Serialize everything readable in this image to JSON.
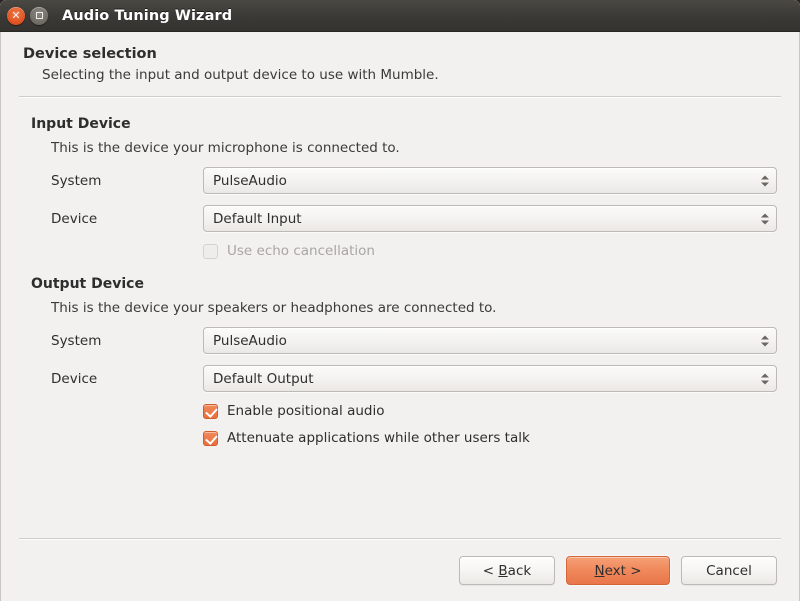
{
  "window": {
    "title": "Audio Tuning Wizard",
    "close_icon": "close-icon",
    "maximize_icon": "maximize-icon"
  },
  "header": {
    "title": "Device selection",
    "subtitle": "Selecting the input and output device to use with Mumble."
  },
  "input_group": {
    "title": "Input Device",
    "description": "This is the device your microphone is connected to.",
    "system_label": "System",
    "system_value": "PulseAudio",
    "device_label": "Device",
    "device_value": "Default Input",
    "echo_label": "Use echo cancellation",
    "echo_checked": false,
    "echo_enabled": false
  },
  "output_group": {
    "title": "Output Device",
    "description": "This is the device your speakers or headphones are connected to.",
    "system_label": "System",
    "system_value": "PulseAudio",
    "device_label": "Device",
    "device_value": "Default Output",
    "positional_label": "Enable positional audio",
    "positional_checked": true,
    "attenuate_label": "Attenuate applications while other users talk",
    "attenuate_checked": true
  },
  "footer": {
    "back_label": "< Back",
    "next_label": "Next >",
    "cancel_label": "Cancel"
  },
  "colors": {
    "accent": "#e8703c",
    "titlebar": "#3b3935",
    "window_background": "#f2f1f0",
    "close_button": "#df5120"
  }
}
